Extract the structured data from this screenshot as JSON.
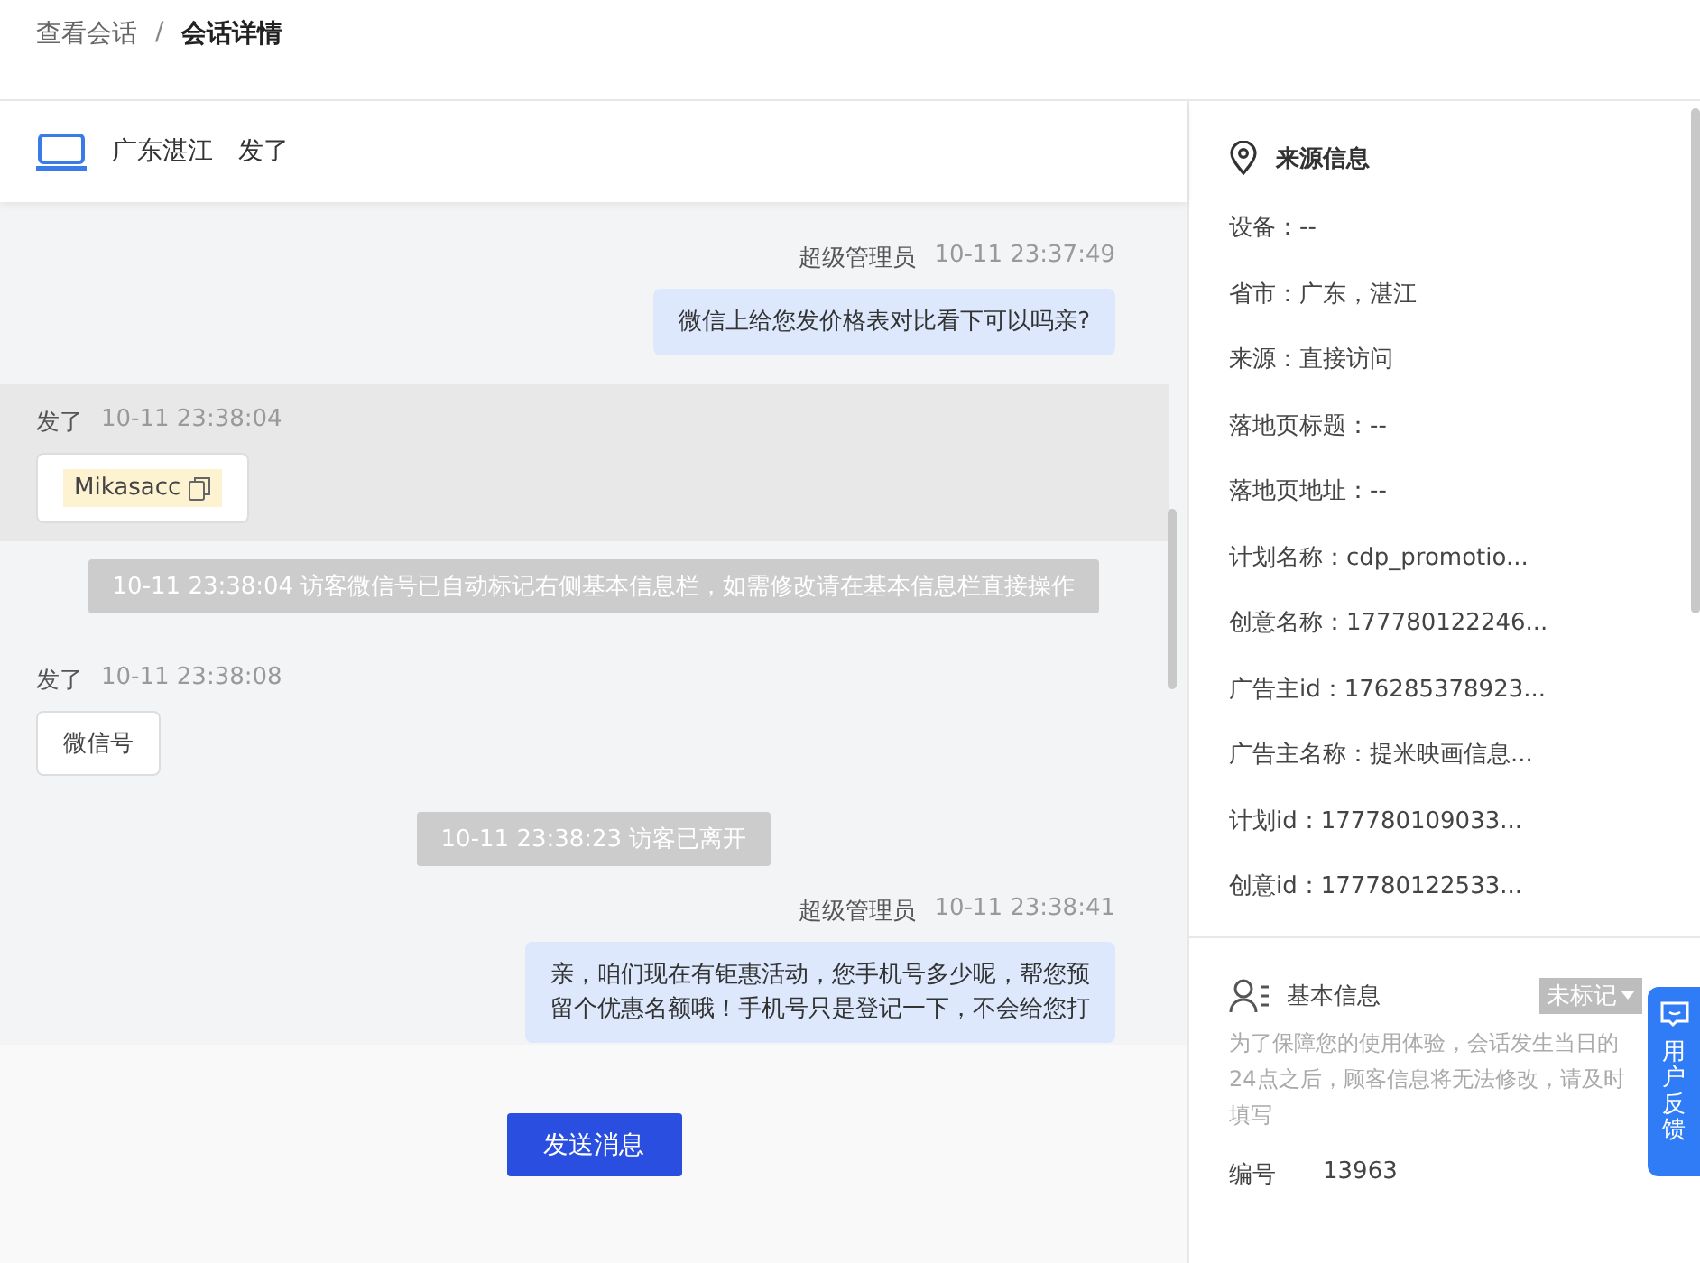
{
  "breadcrumb_separator": "/",
  "breadcrumb": [
    {
      "label": "查看会话",
      "selected": false
    },
    {
      "label": "会话详情",
      "selected": true
    }
  ],
  "chat_header": {
    "location": "广东湛江",
    "visitor": "发了"
  },
  "messages": [
    {
      "kind": "agent",
      "sender": "超级管理员",
      "time": "10-11 23:37:49",
      "lines": [
        "微信上给您发价格表对比看下可以吗亲?"
      ]
    },
    {
      "kind": "visitor",
      "sender": "发了",
      "time": "10-11 23:38:04",
      "text": "Mikasacc",
      "copyable": true,
      "highlighted": true
    },
    {
      "kind": "system",
      "text": "10-11 23:38:04 访客微信号已自动标记右侧基本信息栏，如需修改请在基本信息栏直接操作"
    },
    {
      "kind": "visitor",
      "sender": "发了",
      "time": "10-11 23:38:08",
      "text": "微信号",
      "copyable": false,
      "highlighted": false
    },
    {
      "kind": "system",
      "text": "10-11 23:38:23 访客已离开"
    },
    {
      "kind": "agent",
      "sender": "超级管理员",
      "time": "10-11 23:38:41",
      "lines": [
        "亲，咱们现在有钜惠活动，您手机号多少呢，帮您预",
        "留个优惠名额哦！手机号只是登记一下，不会给您打"
      ]
    }
  ],
  "send_button": "发送消息",
  "source_info": {
    "title": "来源信息",
    "fields": [
      "设备：--",
      "省市：广东，湛江",
      "来源：直接访问",
      "落地页标题：--",
      "落地页地址：--",
      "计划名称：cdp_promotio...",
      "创意名称：177780122246...",
      "广告主id：176285378923...",
      "广告主名称：提米映画信息...",
      "计划id：177780109033...",
      "创意id：177780122533..."
    ]
  },
  "basic_info": {
    "title": "基本信息",
    "tag": "未标记",
    "hint": "为了保障您的使用体验，会话发生当日的24点之后，顾客信息将无法修改，请及时填写",
    "fields": [
      {
        "label": "编号",
        "value": "13963"
      }
    ]
  },
  "feedback_button": "用户反馈"
}
